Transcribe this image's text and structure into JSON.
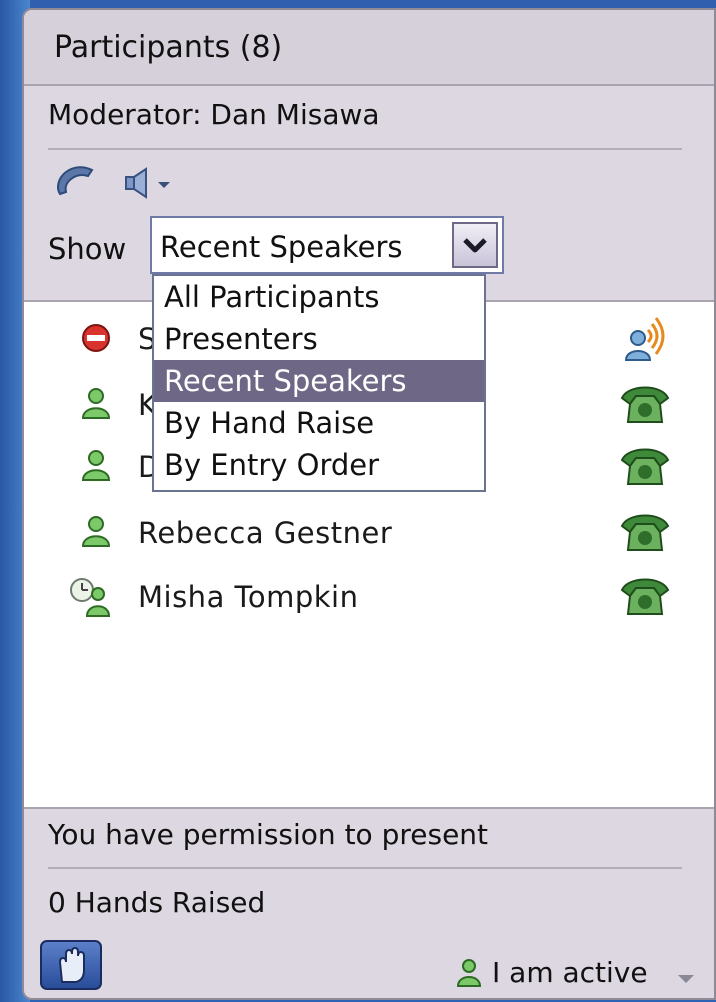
{
  "panel": {
    "title": "Participants (8)",
    "moderator": "Moderator:  Dan Misawa"
  },
  "filter": {
    "label": "Show",
    "selected": "Recent Speakers",
    "options": [
      "All Participants",
      "Presenters",
      "Recent Speakers",
      "By Hand Raise",
      "By Entry Order"
    ]
  },
  "participants": [
    {
      "name": "S",
      "status_icon": "blocked-icon",
      "audio_icon": "speaking-icon"
    },
    {
      "name": "K",
      "status_icon": "person-icon",
      "audio_icon": "phone-icon"
    },
    {
      "name": "D",
      "status_icon": "person-icon",
      "audio_icon": "phone-icon"
    },
    {
      "name": "Rebecca Gestner",
      "status_icon": "person-icon",
      "audio_icon": "phone-icon"
    },
    {
      "name": "Misha Tompkin",
      "status_icon": "away-person-icon",
      "audio_icon": "phone-icon"
    }
  ],
  "footer": {
    "permission_text": "You have permission to present",
    "hands_raised": "0 Hands Raised",
    "status_label": "I am active"
  },
  "colors": {
    "panel_bg": "#dcd7e0",
    "selected_option_bg": "#6e6886",
    "phone_green": "#3f8a3a",
    "speaking_orange": "#e68a1e"
  }
}
